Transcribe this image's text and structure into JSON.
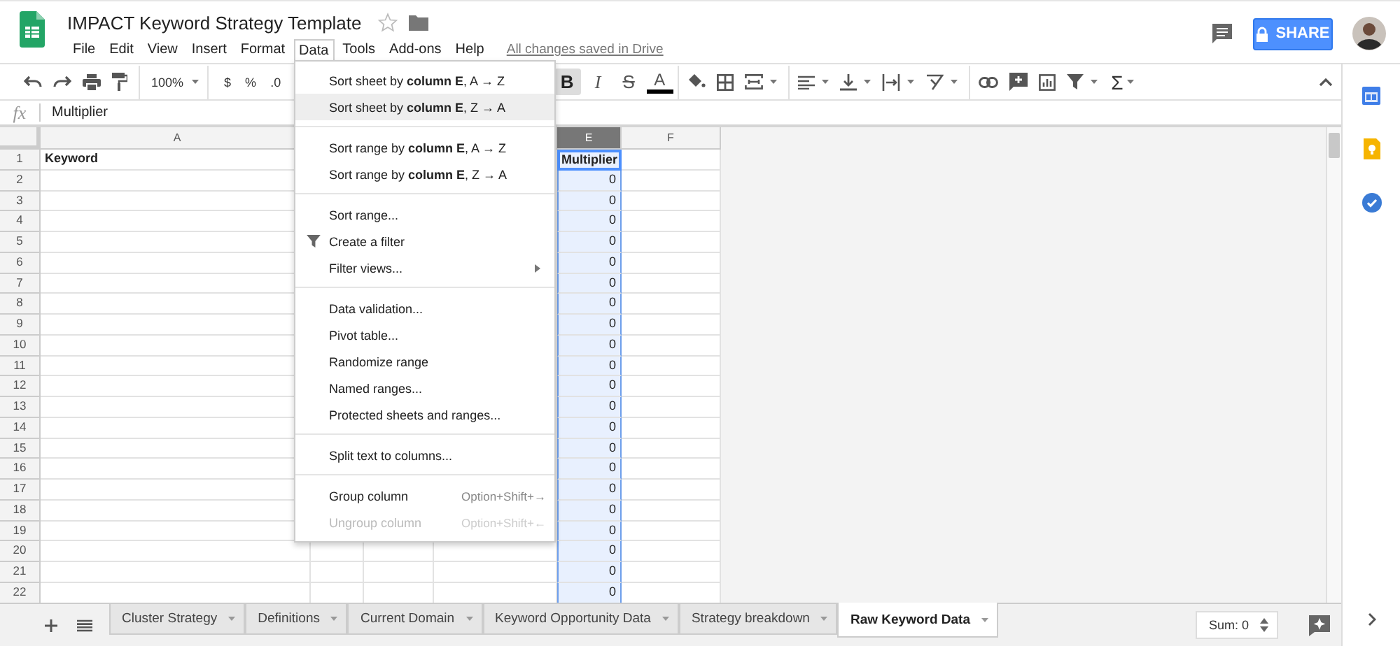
{
  "document": {
    "title": "IMPACT Keyword Strategy Template",
    "starred": false,
    "save_status": "All changes saved in Drive"
  },
  "menu_bar": [
    {
      "label": "File",
      "selected": false
    },
    {
      "label": "Edit",
      "selected": false
    },
    {
      "label": "View",
      "selected": false
    },
    {
      "label": "Insert",
      "selected": false
    },
    {
      "label": "Format",
      "selected": false
    },
    {
      "label": "Data",
      "selected": true
    },
    {
      "label": "Tools",
      "selected": false
    },
    {
      "label": "Add-ons",
      "selected": false
    },
    {
      "label": "Help",
      "selected": false
    }
  ],
  "share_button": {
    "label": "SHARE"
  },
  "toolbar": {
    "zoom": "100%",
    "currency": "$",
    "percent": "%",
    "decimal": ".0",
    "functions": "Σ",
    "format_buttons": [
      {
        "kind": "bold",
        "label": "B",
        "on": true
      },
      {
        "kind": "italic",
        "label": "I",
        "on": false
      },
      {
        "kind": "strike",
        "label": "S",
        "on": false
      },
      {
        "kind": "color",
        "label": "A",
        "on": false
      }
    ]
  },
  "formula_bar": {
    "label": "fx",
    "value": "Multiplier"
  },
  "grid": {
    "columns": [
      {
        "label": "A",
        "selected": false
      },
      {
        "label": "E",
        "selected": true
      },
      {
        "label": "F",
        "selected": false
      }
    ],
    "rows": [
      {
        "number": "1",
        "kind": "header",
        "a": "Keyword",
        "e": "Multiplier",
        "e_active": true
      },
      {
        "number": "2",
        "kind": "data",
        "e": "0",
        "e_active": false
      },
      {
        "number": "3",
        "kind": "data",
        "e": "0",
        "e_active": false
      },
      {
        "number": "4",
        "kind": "data",
        "e": "0",
        "e_active": false
      },
      {
        "number": "5",
        "kind": "data",
        "e": "0",
        "e_active": false
      },
      {
        "number": "6",
        "kind": "data",
        "e": "0",
        "e_active": false
      },
      {
        "number": "7",
        "kind": "data",
        "e": "0",
        "e_active": false
      },
      {
        "number": "8",
        "kind": "data",
        "e": "0",
        "e_active": false
      },
      {
        "number": "9",
        "kind": "data",
        "e": "0",
        "e_active": false
      },
      {
        "number": "10",
        "kind": "data",
        "e": "0",
        "e_active": false
      },
      {
        "number": "11",
        "kind": "data",
        "e": "0",
        "e_active": false
      },
      {
        "number": "12",
        "kind": "data",
        "e": "0",
        "e_active": false
      },
      {
        "number": "13",
        "kind": "data",
        "e": "0",
        "e_active": false
      },
      {
        "number": "14",
        "kind": "data",
        "e": "0",
        "e_active": false
      },
      {
        "number": "15",
        "kind": "data",
        "e": "0",
        "e_active": false
      },
      {
        "number": "16",
        "kind": "data",
        "e": "0",
        "e_active": false
      },
      {
        "number": "17",
        "kind": "data",
        "e": "0",
        "e_active": false
      },
      {
        "number": "18",
        "kind": "data",
        "e": "0",
        "e_active": false
      },
      {
        "number": "19",
        "kind": "data",
        "e": "0",
        "e_active": false
      },
      {
        "number": "20",
        "kind": "data",
        "e": "0",
        "e_active": false
      },
      {
        "number": "21",
        "kind": "data",
        "e": "0",
        "e_active": false
      },
      {
        "number": "22",
        "kind": "data",
        "e": "0",
        "e_active": false
      }
    ]
  },
  "data_menu": [
    {
      "kind": "item",
      "label": "Sort sheet by **column E**, A → Z",
      "highlighted": false,
      "disabled": false,
      "submenu": false
    },
    {
      "kind": "item",
      "label": "Sort sheet by **column E**, Z → A",
      "highlighted": true,
      "disabled": false,
      "submenu": false
    },
    {
      "kind": "divider"
    },
    {
      "kind": "item",
      "label": "Sort range by **column E**, A → Z",
      "highlighted": false,
      "disabled": false,
      "submenu": false
    },
    {
      "kind": "item",
      "label": "Sort range by **column E**, Z → A",
      "highlighted": false,
      "disabled": false,
      "submenu": false
    },
    {
      "kind": "divider"
    },
    {
      "kind": "item",
      "label": "Sort range...",
      "highlighted": false,
      "disabled": false,
      "submenu": false
    },
    {
      "kind": "filter",
      "label": "Create a filter",
      "highlighted": false,
      "disabled": false,
      "submenu": false
    },
    {
      "kind": "item",
      "label": "Filter views...",
      "highlighted": false,
      "disabled": false,
      "submenu": true
    },
    {
      "kind": "divider"
    },
    {
      "kind": "item",
      "label": "Data validation...",
      "highlighted": false,
      "disabled": false,
      "submenu": false
    },
    {
      "kind": "item",
      "label": "Pivot table...",
      "highlighted": false,
      "disabled": false,
      "submenu": false
    },
    {
      "kind": "item",
      "label": "Randomize range",
      "highlighted": false,
      "disabled": false,
      "submenu": false
    },
    {
      "kind": "item",
      "label": "Named ranges...",
      "highlighted": false,
      "disabled": false,
      "submenu": false
    },
    {
      "kind": "item",
      "label": "Protected sheets and ranges...",
      "highlighted": false,
      "disabled": false,
      "submenu": false
    },
    {
      "kind": "divider"
    },
    {
      "kind": "item",
      "label": "Split text to columns...",
      "highlighted": false,
      "disabled": false,
      "submenu": false
    },
    {
      "kind": "divider"
    },
    {
      "kind": "item",
      "label": "Group column",
      "shortcut": "Option+Shift+→",
      "highlighted": false,
      "disabled": false,
      "submenu": false
    },
    {
      "kind": "item",
      "label": "Ungroup column",
      "shortcut": "Option+Shift+←",
      "highlighted": false,
      "disabled": true,
      "submenu": false
    }
  ],
  "sheet_tabs": [
    {
      "label": "Cluster Strategy",
      "selected": false
    },
    {
      "label": "Definitions",
      "selected": false
    },
    {
      "label": "Current Domain",
      "selected": false
    },
    {
      "label": "Keyword Opportunity Data",
      "selected": false
    },
    {
      "label": "Strategy breakdown",
      "selected": false
    },
    {
      "label": "Raw Keyword Data",
      "selected": true
    }
  ],
  "sum": "Sum: 0"
}
